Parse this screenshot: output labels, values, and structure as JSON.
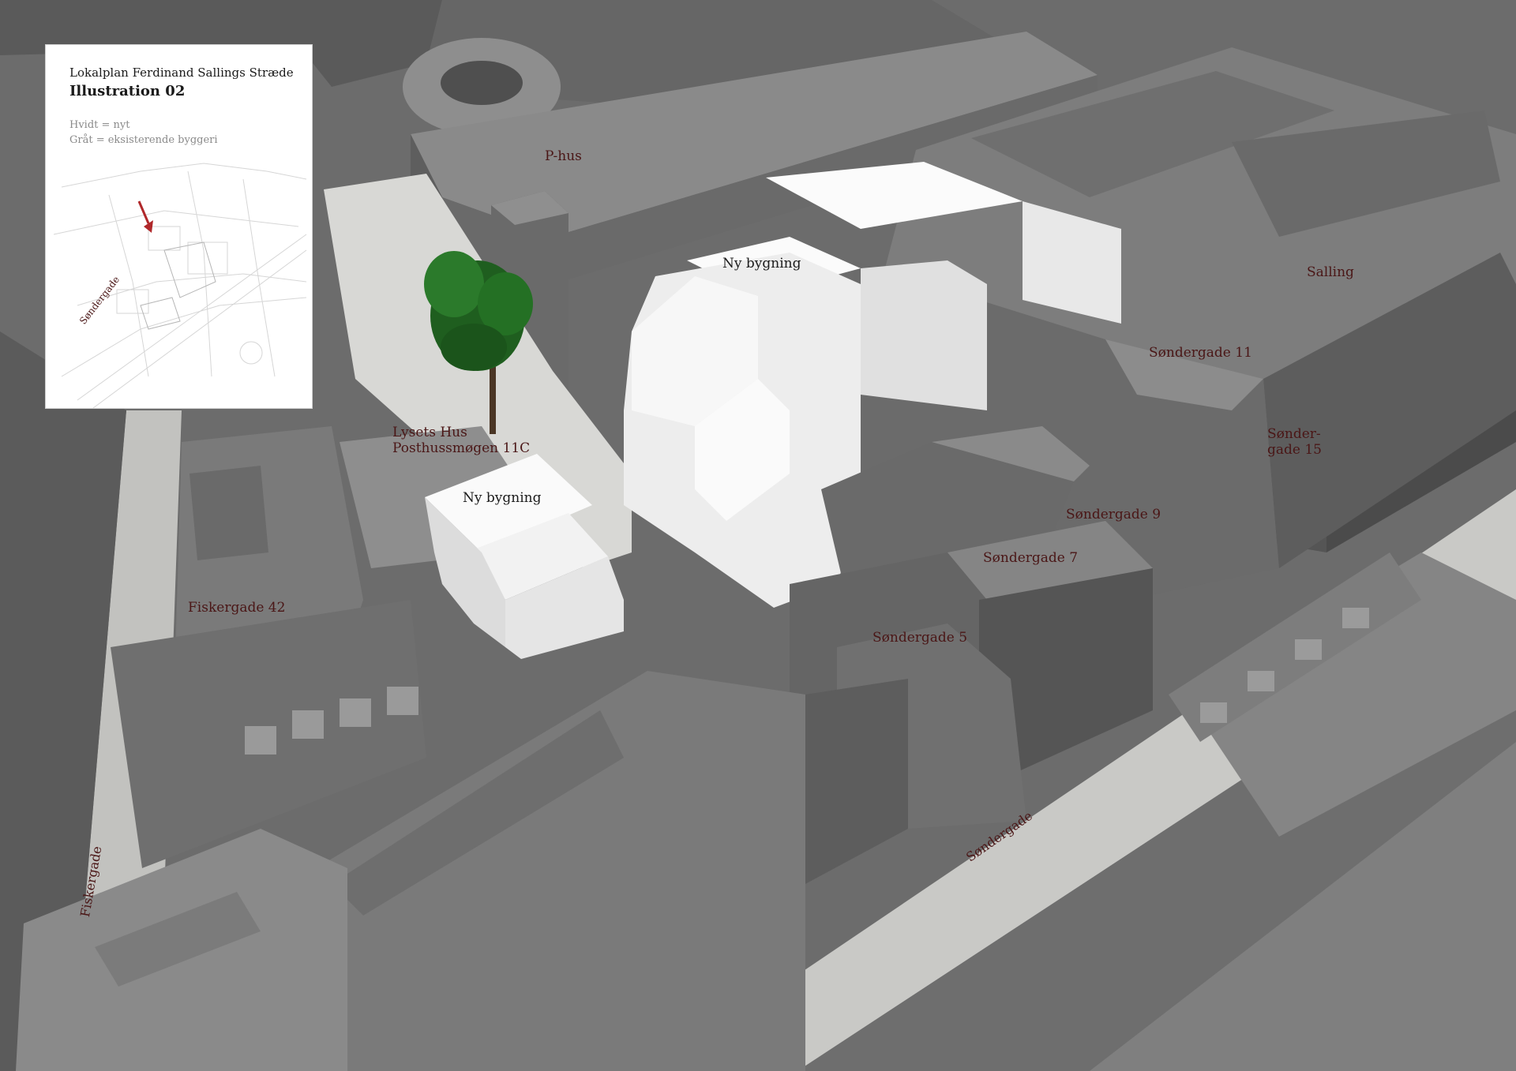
{
  "legend": {
    "plan_title": "Lokalplan Ferdinand Sallings Stræde",
    "illustration": "Illustration 02",
    "white_line": "Hvidt = nyt",
    "grey_line": "Gråt   = eksisterende byggeri",
    "map_street": "Søndergade",
    "arrow_color": "#b0282a"
  },
  "labels": {
    "p_hus": "P-hus",
    "ny_bygning_top": "Ny bygning",
    "salling": "Salling",
    "sondergade_11": "Søndergade 11",
    "sondergade_15": "Sønder-\ngade 15",
    "lysets_hus": "Lysets Hus\nPosthussmøgen 11C",
    "ny_bygning_low": "Ny bygning",
    "sondergade_9": "Søndergade 9",
    "sondergade_7": "Søndergade 7",
    "sondergade_5": "Søndergade 5",
    "fiskergade_42": "Fiskergade 42",
    "sondergade_street": "Søndergade",
    "fiskergade_street": "Fiskergade"
  },
  "colors": {
    "existing": "#7a7a7a",
    "new": "#f4f4f4",
    "street": "#c9c9c6",
    "tree": "#1f5e1f",
    "label": "#4a1616"
  }
}
